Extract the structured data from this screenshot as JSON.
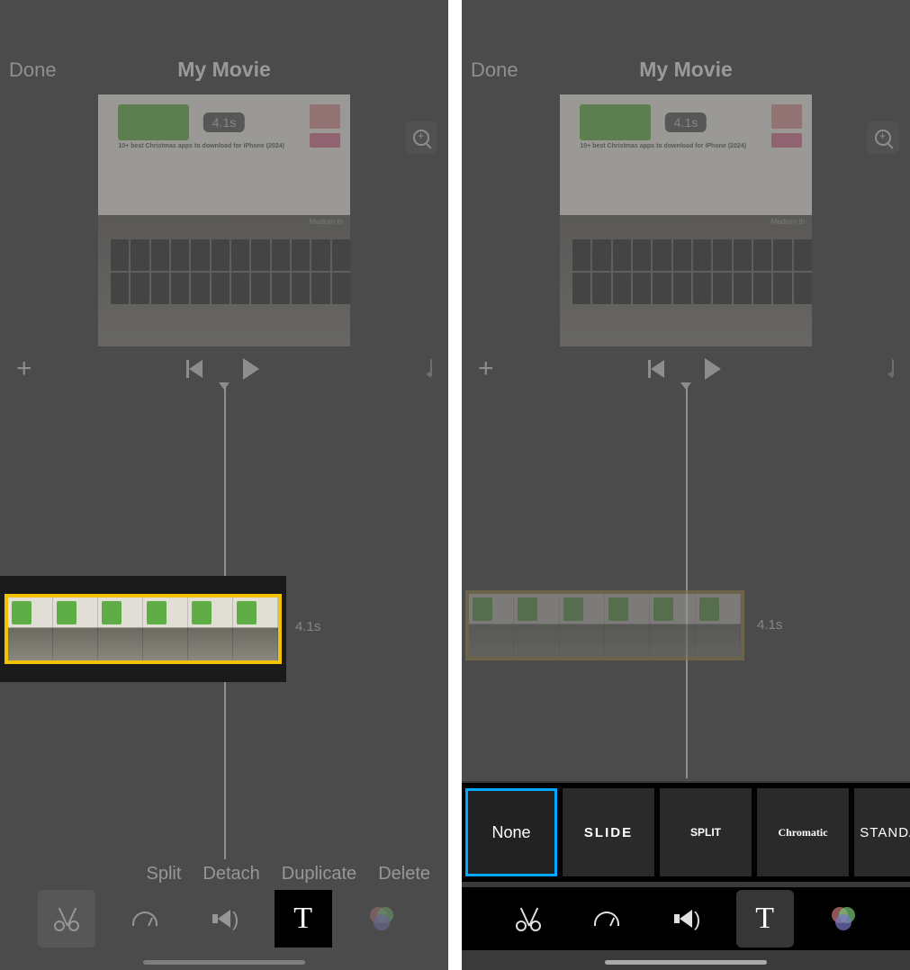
{
  "left": {
    "header": {
      "done": "Done",
      "title": "My Movie"
    },
    "preview": {
      "time_badge": "4.1s",
      "article": "10+ best Christmas apps to download\nfor iPhone (2024)",
      "watermark": "Medium th"
    },
    "clip_duration": "4.1s",
    "actions": {
      "split": "Split",
      "detach": "Detach",
      "duplicate": "Duplicate",
      "delete": "Delete"
    },
    "tools": {
      "text_glyph": "T"
    }
  },
  "right": {
    "header": {
      "done": "Done",
      "title": "My Movie"
    },
    "preview": {
      "time_badge": "4.1s",
      "article": "10+ best Christmas apps to download\nfor iPhone (2024)",
      "watermark": "Medium th"
    },
    "clip_duration": "4.1s",
    "title_styles": {
      "none": "None",
      "slide": "SLIDE",
      "split": "SPLIT",
      "chromatic": "Chromatic",
      "standard": "STANDARD"
    },
    "tools": {
      "text_glyph": "T"
    }
  }
}
